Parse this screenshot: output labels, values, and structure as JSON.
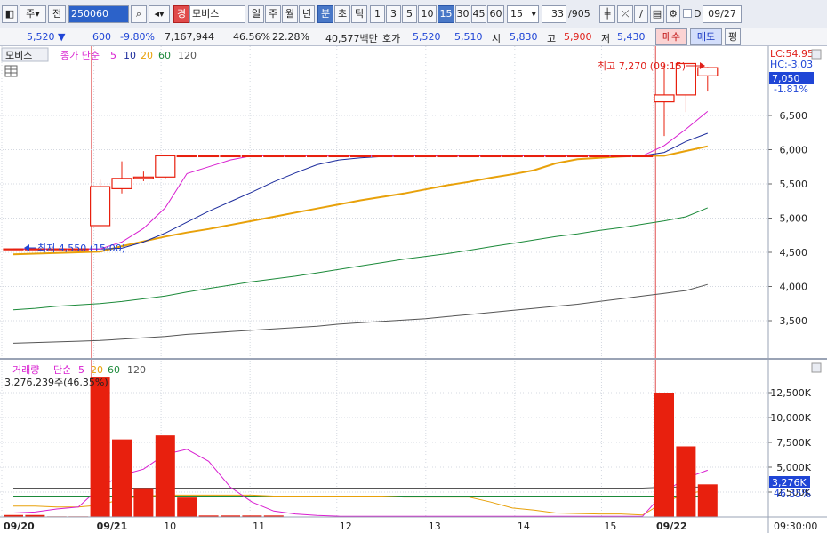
{
  "toolbar": {
    "period_label": "주",
    "prev_label": "전",
    "code": "250060",
    "market_badge": "경",
    "stock_name": "모비스",
    "periods": [
      "일",
      "주",
      "월",
      "년",
      "분",
      "초",
      "틱"
    ],
    "selected_period": "분",
    "minutes": [
      "1",
      "3",
      "5",
      "10",
      "15",
      "30",
      "45",
      "60"
    ],
    "selected_minute": "15",
    "minute_select": "15",
    "count": "33",
    "total": "/905",
    "date_checkbox_label": "D",
    "date_value": "09/27"
  },
  "quote": {
    "price": "5,520",
    "change": "600",
    "change_pct": "-9.80%",
    "volume": "7,167,944",
    "ratio1": "46.56%",
    "ratio2": "22.28%",
    "trade_value": "40,577백만",
    "hoga_label": "호가",
    "ask": "5,520",
    "bid": "5,510",
    "open_label": "시",
    "open": "5,830",
    "high_label": "고",
    "high": "5,900",
    "low_label": "저",
    "low": "5,430",
    "buy_label": "매수",
    "sell_label": "매도",
    "eval_label": "평"
  },
  "price_panel": {
    "title": "모비스",
    "ma_label": "종가 단순",
    "ma_periods": [
      "5",
      "10",
      "20",
      "60",
      "120"
    ],
    "lc": "LC:54.95",
    "hc": "HC:-3.03",
    "last_price": "7,050",
    "last_pct": "-1.81%",
    "high_note": "최고 7,270 (09:15)",
    "low_note": "최저 4,550 (15:00)",
    "y_ticks": [
      "6,500",
      "6,000",
      "5,500",
      "5,000",
      "4,500",
      "4,000",
      "3,500"
    ]
  },
  "volume_panel": {
    "title": "거래량",
    "ma_label": "단순",
    "ma_periods": [
      "5",
      "20",
      "60",
      "120"
    ],
    "value_note": "3,276,239주(46.35%)",
    "last_value": "3,276K",
    "last_pct": "46.35%",
    "y_ticks": [
      "12,500K",
      "10,000K",
      "7,500K",
      "5,000K",
      "2,500K"
    ]
  },
  "x_axis": {
    "labels": [
      "09/20",
      "09/21",
      "10",
      "11",
      "12",
      "13",
      "14",
      "15",
      "09/22"
    ],
    "time": "09:30:00"
  },
  "colors": {
    "up": "#e8200e",
    "down": "#1c5fcf",
    "ma5": "#d81fd0",
    "ma10": "#1b2b9c",
    "ma20": "#e8a10a",
    "ma60": "#1c8a3a",
    "ma120": "#555555"
  },
  "chart_data": {
    "type": "candlestick",
    "candles": [
      {
        "o": 4550,
        "h": 4550,
        "l": 4550,
        "c": 4550
      },
      {
        "o": 4550,
        "h": 4550,
        "l": 4550,
        "c": 4550
      },
      {
        "o": 4550,
        "h": 4550,
        "l": 4550,
        "c": 4550
      },
      {
        "o": 4550,
        "h": 4550,
        "l": 4550,
        "c": 4550
      },
      {
        "o": 4890,
        "h": 5560,
        "l": 4880,
        "c": 5460
      },
      {
        "o": 5430,
        "h": 5830,
        "l": 5360,
        "c": 5580
      },
      {
        "o": 5580,
        "h": 5680,
        "l": 5540,
        "c": 5600
      },
      {
        "o": 5600,
        "h": 5920,
        "l": 5580,
        "c": 5910
      },
      {
        "o": 5910,
        "h": 5910,
        "l": 5910,
        "c": 5910
      },
      {
        "o": 5910,
        "h": 5910,
        "l": 5910,
        "c": 5910
      },
      {
        "o": 5910,
        "h": 5910,
        "l": 5910,
        "c": 5910
      },
      {
        "o": 5910,
        "h": 5910,
        "l": 5910,
        "c": 5910
      },
      {
        "o": 5910,
        "h": 5910,
        "l": 5910,
        "c": 5910
      },
      {
        "o": 5910,
        "h": 5910,
        "l": 5910,
        "c": 5910
      },
      {
        "o": 5910,
        "h": 5910,
        "l": 5910,
        "c": 5910
      },
      {
        "o": 5910,
        "h": 5910,
        "l": 5910,
        "c": 5910
      },
      {
        "o": 5910,
        "h": 5910,
        "l": 5910,
        "c": 5910
      },
      {
        "o": 5910,
        "h": 5910,
        "l": 5910,
        "c": 5910
      },
      {
        "o": 5910,
        "h": 5910,
        "l": 5910,
        "c": 5910
      },
      {
        "o": 5910,
        "h": 5910,
        "l": 5910,
        "c": 5910
      },
      {
        "o": 5910,
        "h": 5910,
        "l": 5910,
        "c": 5910
      },
      {
        "o": 5910,
        "h": 5910,
        "l": 5910,
        "c": 5910
      },
      {
        "o": 5910,
        "h": 5910,
        "l": 5910,
        "c": 5910
      },
      {
        "o": 5910,
        "h": 5910,
        "l": 5910,
        "c": 5910
      },
      {
        "o": 5910,
        "h": 5910,
        "l": 5910,
        "c": 5910
      },
      {
        "o": 5910,
        "h": 5910,
        "l": 5910,
        "c": 5910
      },
      {
        "o": 5910,
        "h": 5910,
        "l": 5910,
        "c": 5910
      },
      {
        "o": 5910,
        "h": 5910,
        "l": 5910,
        "c": 5910
      },
      {
        "o": 5910,
        "h": 5910,
        "l": 5910,
        "c": 5910
      },
      {
        "o": 5910,
        "h": 5910,
        "l": 5910,
        "c": 5910
      },
      {
        "o": 6700,
        "h": 7270,
        "l": 6200,
        "c": 6800
      },
      {
        "o": 6800,
        "h": 7170,
        "l": 6550,
        "c": 7260
      },
      {
        "o": 7080,
        "h": 7210,
        "l": 6850,
        "c": 7200
      }
    ],
    "volume": [
      200,
      200,
      60,
      60,
      14100,
      7800,
      2900,
      8200,
      1950,
      150,
      150,
      150,
      150,
      0,
      0,
      0,
      0,
      0,
      0,
      0,
      0,
      0,
      0,
      0,
      0,
      0,
      0,
      0,
      0,
      0,
      12500,
      7100,
      3276
    ],
    "ma5": [
      4550,
      4550,
      4550,
      4550,
      4550,
      4650,
      4850,
      5150,
      5650,
      5750,
      5850,
      5910,
      5910,
      5910,
      5910,
      5910,
      5910,
      5910,
      5910,
      5910,
      5910,
      5910,
      5910,
      5910,
      5910,
      5910,
      5910,
      5910,
      5910,
      5910,
      6060,
      6300,
      6560
    ],
    "ma10": [
      4550,
      4550,
      4550,
      4550,
      4550,
      4560,
      4650,
      4780,
      4940,
      5100,
      5240,
      5380,
      5530,
      5660,
      5780,
      5850,
      5880,
      5900,
      5910,
      5910,
      5910,
      5910,
      5910,
      5910,
      5910,
      5910,
      5910,
      5910,
      5910,
      5910,
      5960,
      6120,
      6240
    ],
    "ma20": [
      4470,
      4480,
      4490,
      4500,
      4510,
      4590,
      4660,
      4730,
      4790,
      4840,
      4900,
      4960,
      5020,
      5080,
      5140,
      5200,
      5260,
      5310,
      5360,
      5420,
      5480,
      5530,
      5590,
      5640,
      5700,
      5800,
      5860,
      5880,
      5900,
      5910,
      5910,
      5980,
      6050
    ],
    "ma60": [
      3660,
      3680,
      3710,
      3730,
      3750,
      3780,
      3820,
      3860,
      3920,
      3970,
      4020,
      4070,
      4110,
      4150,
      4200,
      4250,
      4300,
      4350,
      4400,
      4440,
      4480,
      4530,
      4580,
      4630,
      4680,
      4730,
      4770,
      4820,
      4860,
      4910,
      4960,
      5020,
      5150
    ],
    "ma120": [
      3170,
      3180,
      3190,
      3200,
      3210,
      3230,
      3250,
      3270,
      3300,
      3320,
      3340,
      3360,
      3380,
      3400,
      3420,
      3450,
      3470,
      3490,
      3510,
      3530,
      3560,
      3590,
      3620,
      3650,
      3680,
      3710,
      3740,
      3780,
      3820,
      3860,
      3900,
      3940,
      4030
    ],
    "vol_ma5": [
      400,
      500,
      800,
      1000,
      3000,
      4200,
      4800,
      6300,
      6800,
      5600,
      3000,
      1500,
      600,
      300,
      150,
      80,
      60,
      60,
      60,
      60,
      60,
      60,
      60,
      60,
      60,
      60,
      60,
      60,
      60,
      60,
      2500,
      3900,
      4700
    ],
    "vol_ma20": [
      1100,
      1100,
      1000,
      1000,
      1200,
      1800,
      2100,
      2200,
      2200,
      2200,
      2200,
      2200,
      2100,
      2100,
      2100,
      2100,
      2100,
      2100,
      2000,
      2000,
      2000,
      2000,
      1500,
      900,
      700,
      400,
      350,
      300,
      300,
      200,
      1500,
      2300,
      2700
    ],
    "vol_ma60": [
      2100,
      2100,
      2100,
      2100,
      2100,
      2100,
      2100,
      2100,
      2100,
      2100,
      2100,
      2100,
      2100,
      2100,
      2100,
      2100,
      2100,
      2100,
      2100,
      2100,
      2100,
      2100,
      2100,
      2100,
      2100,
      2100,
      2100,
      2100,
      2100,
      2100,
      2100,
      2100,
      2100
    ],
    "vol_ma120": [
      2900,
      2900,
      2900,
      2900,
      2900,
      2900,
      2900,
      2900,
      2900,
      2900,
      2900,
      2900,
      2900,
      2900,
      2900,
      2900,
      2900,
      2900,
      2900,
      2900,
      2900,
      2900,
      2900,
      2900,
      2900,
      2900,
      2900,
      2900,
      2900,
      2900,
      3000,
      3000,
      3000
    ],
    "price_ylim": [
      3000,
      7500
    ],
    "volume_ylim": [
      0,
      14500
    ]
  }
}
